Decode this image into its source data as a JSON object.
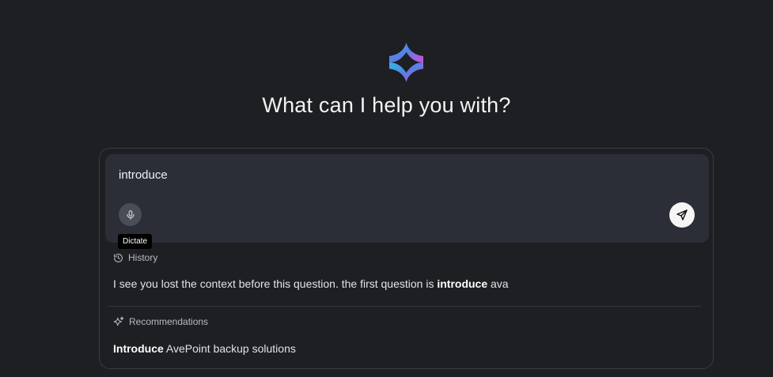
{
  "heading": "What can I help you with?",
  "input": {
    "value": "introduce",
    "dictate_tooltip": "Dictate"
  },
  "history": {
    "label": "History",
    "item": {
      "before": "I see you lost the context before this question. the first question is ",
      "highlight": "introduce",
      "after": " ava"
    }
  },
  "recommendations": {
    "label": "Recommendations",
    "item": {
      "highlight": "Introduce",
      "after": " AvePoint backup solutions"
    }
  },
  "colors": {
    "background": "#1e1f22",
    "input_background": "#2b2e36",
    "logo_gradient_start": "#3ab0e6",
    "logo_gradient_end": "#c94fd8"
  }
}
